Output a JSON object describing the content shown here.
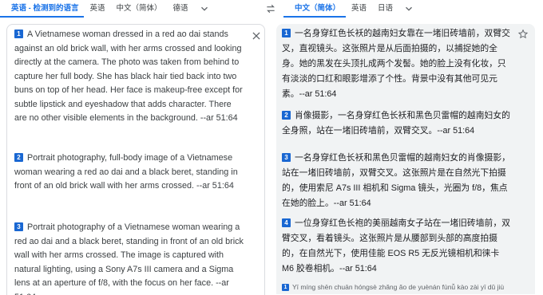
{
  "source_langs": {
    "detected": "英语 - 检测到的语言",
    "opt1": "英语",
    "opt2": "中文（简体）",
    "opt3": "德语"
  },
  "target_langs": {
    "selected": "中文（简体）",
    "opt1": "英语",
    "opt2": "日语"
  },
  "source_paragraphs": [
    {
      "num": "1",
      "text": "A Vietnamese woman dressed in a red ao dai stands against an old brick wall, with her arms crossed and looking directly at the camera. The photo was taken from behind to capture her full body. She has black hair tied back into two buns on top of her head. Her face is makeup-free except for subtle lipstick and eyeshadow that adds character. There are no other visible elements in the background. --ar 51:64"
    },
    {
      "num": "2",
      "text": "Portrait photography, full-body image of a Vietnamese woman wearing a red ao dai and a black beret, standing in front of an old brick wall with her arms crossed. --ar 51:64"
    },
    {
      "num": "3",
      "text": "Portrait photography of a Vietnamese woman wearing a red ao dai and a black beret, standing in front of an old brick wall with her arms crossed. The image is captured with natural lighting, using a Sony A7s III camera and a Sigma lens at an aperture of f/8, with the focus on her face. --ar 51:64"
    }
  ],
  "target_paragraphs": [
    {
      "num": "1",
      "text": "一名身穿红色长袄的越南妇女靠在一堵旧砖墙前，双臂交叉，直视镜头。这张照片是从后面拍摄的，以捕捉她的全身。她的黑发在头顶扎成两个发髻。她的脸上没有化妆，只有淡淡的口红和眼影增添了个性。背景中没有其他可见元素。--ar 51:64"
    },
    {
      "num": "2",
      "text": "肖像摄影，一名身穿红色长袄和黑色贝雷帽的越南妇女的全身照，站在一堵旧砖墙前，双臂交叉。--ar 51:64"
    },
    {
      "num": "3",
      "text": "一名身穿红色长袄和黑色贝雷帽的越南妇女的肖像摄影，站在一堵旧砖墙前，双臂交叉。这张照片是在自然光下拍摄的，使用索尼 A7s III 相机和 Sigma 镜头，光圈为 f/8，焦点在她的脸上。--ar 51:64"
    },
    {
      "num": "4",
      "text": "一位身穿红色长袍的美丽越南女子站在一堵旧砖墙前，双臂交叉，看着镜头。这张照片是从腰部到头部的高度拍摄的，在自然光下，使用佳能 EOS R5 无反光镜相机和徕卡 M6 胶卷相机。--ar 51:64"
    }
  ],
  "pinyin": {
    "num": "1",
    "text": "Yī míng shēn chuān hóngsè zhǎng ǎo de yuènán fùnǚ kào zài yī dǔ jiù"
  },
  "icons": {
    "close": "close-icon",
    "star": "star-icon",
    "swap": "swap-icon",
    "chevron": "chevron-down-icon"
  },
  "colors": {
    "accent": "#1a73e8",
    "badge": "#1967d2",
    "target_bg": "#f1f3f4"
  }
}
